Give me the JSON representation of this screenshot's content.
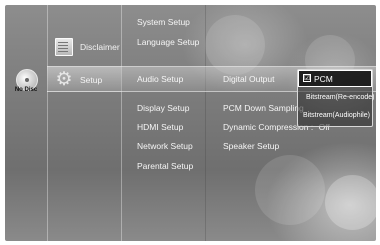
{
  "disc": {
    "label": "No Disc",
    "icon": "disc-icon"
  },
  "menu": {
    "items": [
      {
        "label": "Disclaimer",
        "icon": "document-icon",
        "selected": false
      },
      {
        "label": "Setup",
        "icon": "gear-icon",
        "selected": true
      }
    ]
  },
  "submenu": {
    "items": [
      {
        "label": "System Setup"
      },
      {
        "label": "Language Setup"
      },
      {
        "label": "Audio Setup",
        "selected": true
      },
      {
        "label": "Display Setup"
      },
      {
        "label": "HDMI Setup"
      },
      {
        "label": "Network Setup"
      },
      {
        "label": "Parental Setup"
      }
    ]
  },
  "audio_options": {
    "digital_output": "Digital Output",
    "pcm_down_sampling": "PCM Down Sampling",
    "dynamic_compression": "Dynamic Compression :",
    "dynamic_compression_value": "Off",
    "speaker_setup": "Speaker Setup"
  },
  "digital_output_popup": {
    "options": [
      {
        "label": "PCM",
        "checked": true
      },
      {
        "label": "Bitstream(Re-encode)",
        "checked": false
      },
      {
        "label": "Bitstream(Audiophile)",
        "checked": false
      }
    ],
    "check_glyph": "☑"
  }
}
